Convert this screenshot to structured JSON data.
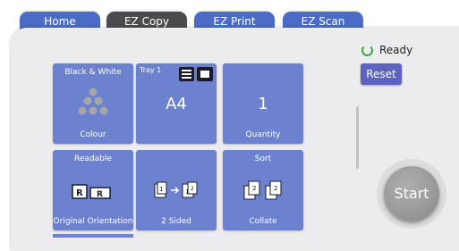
{
  "tabs": [
    {
      "label": "Home"
    },
    {
      "label": "EZ Copy"
    },
    {
      "label": "EZ Print"
    },
    {
      "label": "EZ Scan"
    }
  ],
  "status": {
    "label": "Ready"
  },
  "reset_label": "Reset",
  "start_label": "Start",
  "tiles": {
    "color": {
      "top": "Black & White",
      "bottom": "Colour"
    },
    "tray": {
      "label": "Tray 1",
      "value": "A4"
    },
    "quantity": {
      "value": "1",
      "bottom": "Quantity"
    },
    "orientation": {
      "top": "Readable",
      "bottom": "Original Orientation"
    },
    "sided": {
      "bottom": "2 Sided"
    },
    "collate": {
      "top": "Sort",
      "bottom": "Collate"
    }
  },
  "colors": {
    "tile": "#6d82cf",
    "tab": "#4a6cc4",
    "active_tab": "#4b4b4f",
    "ready": "#3ea84a",
    "reset": "#5e63c2"
  },
  "icons": [
    "dots-icon",
    "tray-icon",
    "orientation-icon",
    "duplex-icon",
    "collate-icon"
  ]
}
